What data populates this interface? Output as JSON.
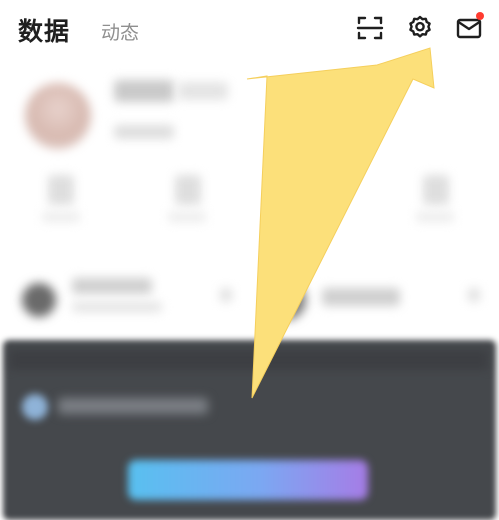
{
  "header": {
    "active_tab": "数据",
    "inactive_tab": "动态",
    "icons": [
      "scan-icon",
      "gear-icon",
      "mail-icon"
    ],
    "notification_dot_color": "#ff3b30"
  },
  "annotation": {
    "arrow_color": "#fce07a",
    "points_to": "gear-icon"
  }
}
